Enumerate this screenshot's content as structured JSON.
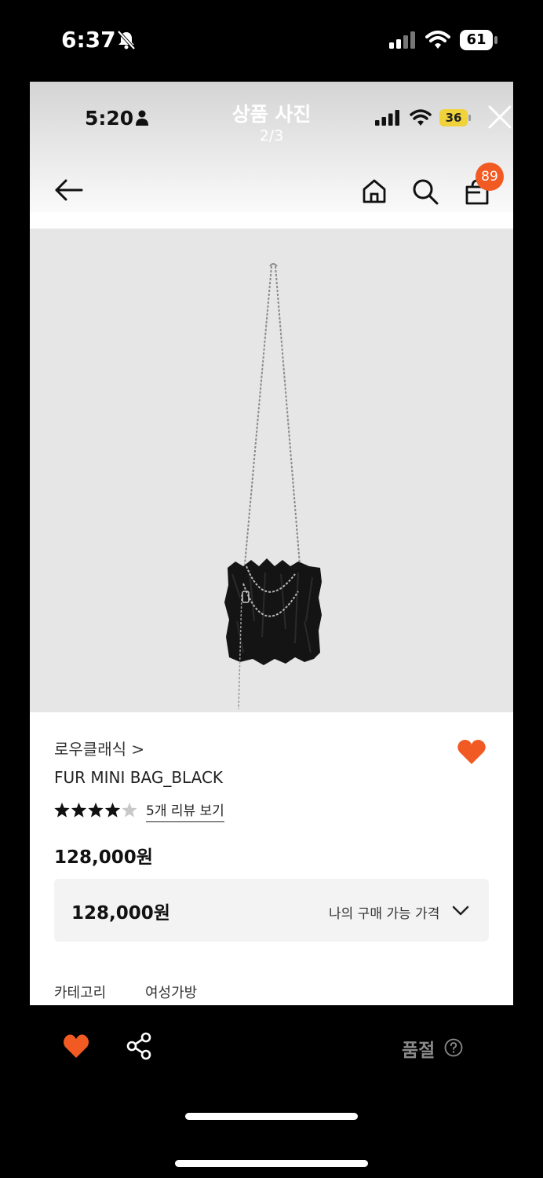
{
  "outer_status": {
    "time": "6:37",
    "bell_icon": "bell-slash-icon",
    "battery": "61"
  },
  "viewer": {
    "time": "5:20",
    "title": "상품 사진",
    "counter": "2/3",
    "battery": "36",
    "close_icon": "close-icon"
  },
  "nav": {
    "back_icon": "arrow-left-icon",
    "home_icon": "home-icon",
    "search_icon": "search-icon",
    "cart_icon": "cart-icon",
    "cart_badge": "89"
  },
  "product": {
    "image_icon": "fur-mini-bag-photo",
    "brand": "로우클래식 >",
    "name": "FUR MINI BAG_BLACK",
    "rating": 4.5,
    "rating_max": 5,
    "review_link": "5개 리뷰 보기",
    "price": "128,000원",
    "accent_color": "#f25a23"
  },
  "price_box": {
    "value": "128,000원",
    "label": "나의 구매 가능 가격"
  },
  "category": {
    "label": "카테고리",
    "value": "여성가방"
  },
  "bottom_bar": {
    "heart_icon": "heart-icon",
    "share_icon": "share-icon",
    "soldout": "품절",
    "help_icon": "question-circle-icon"
  }
}
